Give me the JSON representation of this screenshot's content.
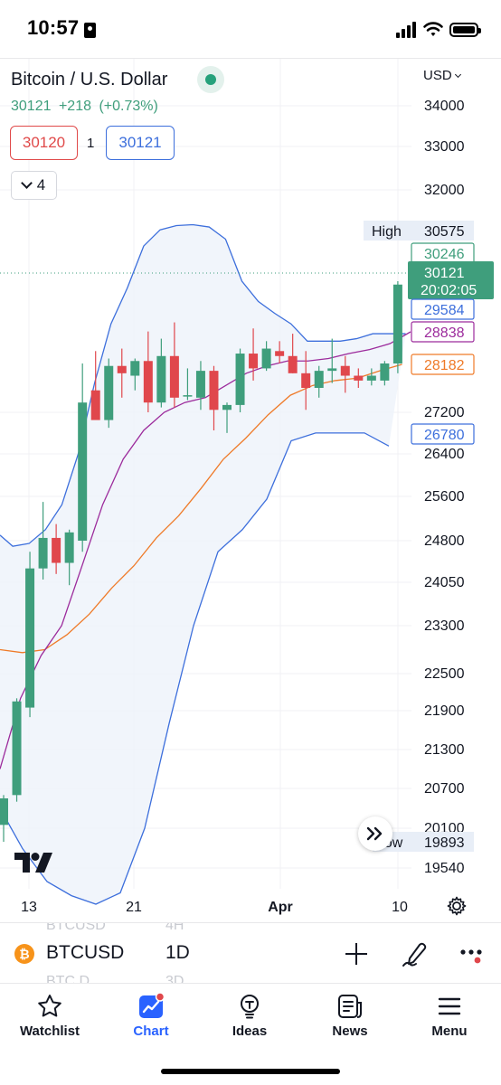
{
  "status_bar": {
    "time": "10:57"
  },
  "header": {
    "symbol_title": "Bitcoin / U.S. Dollar",
    "last_price": "30121",
    "change": "+218",
    "change_pct": "(+0.73%)",
    "sell_price": "30120",
    "quantity": "1",
    "buy_price": "30121",
    "indicators_count": "4",
    "currency": "USD"
  },
  "colors": {
    "up": "#3f9e7c",
    "down": "#e0474c",
    "bollinger": "#3d6fdc",
    "sma_fast": "#9c2b9c",
    "sma_slow": "#ef7a28",
    "accent": "#2962ff"
  },
  "price_axis": {
    "ticks": [
      "34000",
      "33000",
      "32000",
      "27200",
      "26400",
      "25600",
      "24800",
      "24050",
      "23300",
      "22500",
      "21900",
      "21300",
      "20700",
      "20100",
      "19540"
    ],
    "high_label": "High",
    "low_label": "Low",
    "markers": {
      "high": "30575",
      "bb_upper": "30246",
      "last_price": "30121",
      "countdown": "20:02:05",
      "bb_basis": "29584",
      "sma_fast": "28838",
      "sma_slow": "28182",
      "bb_lower": "26780",
      "low": "19893"
    }
  },
  "time_axis": {
    "labels": [
      "13",
      "21",
      "Apr",
      "10"
    ]
  },
  "chart_data": {
    "type": "candlestick",
    "symbol": "BTCUSD",
    "interval": "1D",
    "candles": [
      {
        "o": 20150,
        "h": 20600,
        "l": 19893,
        "c": 20550
      },
      {
        "o": 20600,
        "h": 22100,
        "l": 20500,
        "c": 22050
      },
      {
        "o": 21950,
        "h": 24600,
        "l": 21800,
        "c": 24300
      },
      {
        "o": 24300,
        "h": 25500,
        "l": 24100,
        "c": 24850
      },
      {
        "o": 24850,
        "h": 25100,
        "l": 24200,
        "c": 24400
      },
      {
        "o": 24400,
        "h": 25000,
        "l": 24000,
        "c": 24950
      },
      {
        "o": 24800,
        "h": 28200,
        "l": 24600,
        "c": 27400
      },
      {
        "o": 27650,
        "h": 28450,
        "l": 27100,
        "c": 27050
      },
      {
        "o": 27050,
        "h": 28300,
        "l": 26900,
        "c": 28150
      },
      {
        "o": 28150,
        "h": 28500,
        "l": 27500,
        "c": 28000
      },
      {
        "o": 27950,
        "h": 28300,
        "l": 27650,
        "c": 28250
      },
      {
        "o": 28250,
        "h": 28850,
        "l": 27200,
        "c": 27400
      },
      {
        "o": 27400,
        "h": 28700,
        "l": 27300,
        "c": 28350
      },
      {
        "o": 28350,
        "h": 29150,
        "l": 27300,
        "c": 27500
      },
      {
        "o": 27550,
        "h": 28100,
        "l": 27450,
        "c": 27550
      },
      {
        "o": 27500,
        "h": 28250,
        "l": 27250,
        "c": 28050
      },
      {
        "o": 28050,
        "h": 28150,
        "l": 26850,
        "c": 27250
      },
      {
        "o": 27250,
        "h": 27400,
        "l": 26800,
        "c": 27350
      },
      {
        "o": 27350,
        "h": 28500,
        "l": 27200,
        "c": 28400
      },
      {
        "o": 28400,
        "h": 28950,
        "l": 27850,
        "c": 28100
      },
      {
        "o": 28100,
        "h": 28650,
        "l": 28050,
        "c": 28500
      },
      {
        "o": 28450,
        "h": 28650,
        "l": 28200,
        "c": 28350
      },
      {
        "o": 28350,
        "h": 28800,
        "l": 28000,
        "c": 28000
      },
      {
        "o": 28000,
        "h": 28450,
        "l": 27250,
        "c": 27700
      },
      {
        "o": 27700,
        "h": 28150,
        "l": 27500,
        "c": 28050
      },
      {
        "o": 28050,
        "h": 28700,
        "l": 27800,
        "c": 28100
      },
      {
        "o": 28150,
        "h": 28350,
        "l": 27600,
        "c": 27950
      },
      {
        "o": 27950,
        "h": 28100,
        "l": 27700,
        "c": 27850
      },
      {
        "o": 27850,
        "h": 28100,
        "l": 27750,
        "c": 27950
      },
      {
        "o": 27850,
        "h": 28250,
        "l": 27750,
        "c": 28200
      },
      {
        "o": 28200,
        "h": 30000,
        "l": 28000,
        "c": 29950
      }
    ],
    "bollinger_upper": [
      24900,
      24700,
      24750,
      25000,
      25450,
      26400,
      27800,
      29100,
      29900,
      30350,
      30600,
      30750,
      30780,
      30700,
      30450,
      30000,
      29700,
      29450,
      29100,
      28650,
      28650,
      28650,
      28700,
      28800,
      28800,
      28800
    ],
    "bollinger_lower": [
      20400,
      19800,
      19300,
      19050,
      18900,
      19100,
      20100,
      21700,
      23300,
      24600,
      25000,
      25550,
      26650,
      26800,
      26800,
      26800,
      26550
    ],
    "sma_fast": [
      21000,
      22100,
      22800,
      23300,
      24350,
      25450,
      26300,
      26850,
      27200,
      27400,
      27500,
      27750,
      28000,
      28150,
      28250,
      28250,
      28300,
      28400,
      28480,
      28600,
      28838
    ],
    "sma_slow": [
      22900,
      22850,
      22900,
      23150,
      23500,
      23950,
      24350,
      24850,
      25250,
      25750,
      26300,
      26700,
      27150,
      27550,
      27750,
      27850,
      27900,
      28050,
      28182
    ],
    "time_labels": [
      "13",
      "21",
      "Apr",
      "10"
    ]
  },
  "symbol_bar": {
    "ghost_prev_symbol": "BTCUSD",
    "ghost_prev_interval": "4H",
    "symbol": "BTCUSD",
    "interval": "1D",
    "ghost_next_symbol": "BTC.D",
    "ghost_next_interval": "3D",
    "badge": "₿"
  },
  "tabs": [
    {
      "label": "Watchlist",
      "icon": "star-icon"
    },
    {
      "label": "Chart",
      "icon": "chart-icon"
    },
    {
      "label": "Ideas",
      "icon": "lightbulb-icon"
    },
    {
      "label": "News",
      "icon": "news-icon"
    },
    {
      "label": "Menu",
      "icon": "menu-icon"
    }
  ]
}
